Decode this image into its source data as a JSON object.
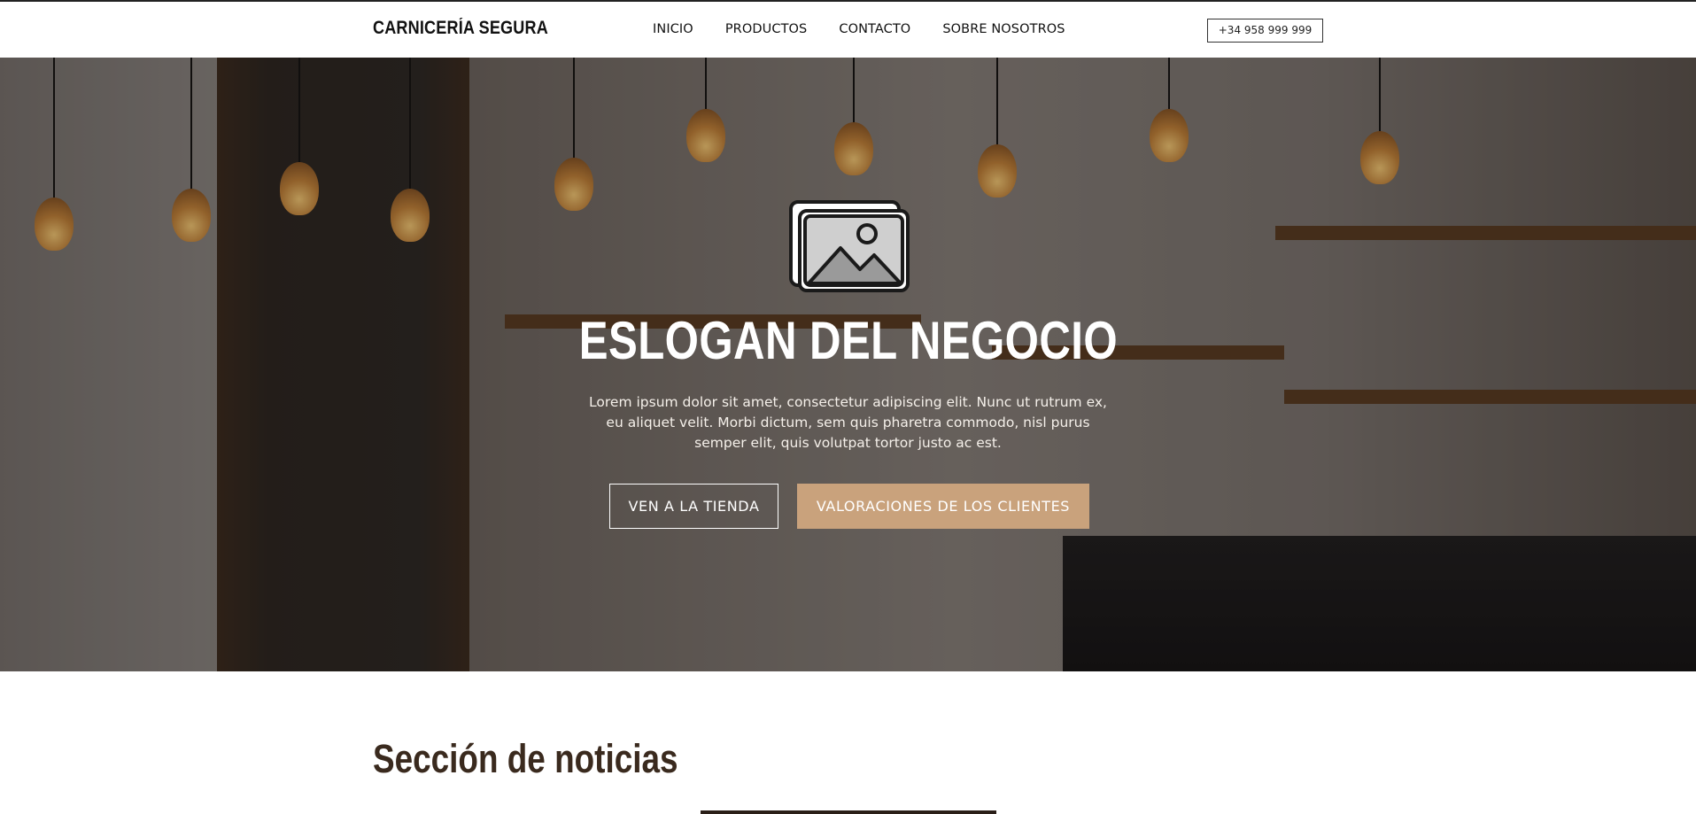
{
  "header": {
    "brand": "CARNICERÍA SEGURA",
    "nav": [
      "INICIO",
      "PRODUCTOS",
      "CONTACTO",
      "SOBRE NOSOTROS"
    ],
    "phone": "+34 958 999 999"
  },
  "hero": {
    "image_icon": "image-placeholder-icon",
    "slogan": "ESLOGAN DEL NEGOCIO",
    "lorem": "Lorem ipsum dolor sit amet, consectetur adipiscing elit. Nunc ut rutrum ex, eu aliquet velit. Morbi dictum, sem quis pharetra commodo, nisl purus semper elit, quis volutpat tortor justo ac est.",
    "buttons": {
      "store": "VEN A LA TIENDA",
      "reviews": "VALORACIONES DE LOS CLIENTES"
    }
  },
  "news": {
    "title": "Sección de noticias"
  },
  "colors": {
    "accent": "#c9a27c",
    "text_dark": "#3a2a1e"
  }
}
